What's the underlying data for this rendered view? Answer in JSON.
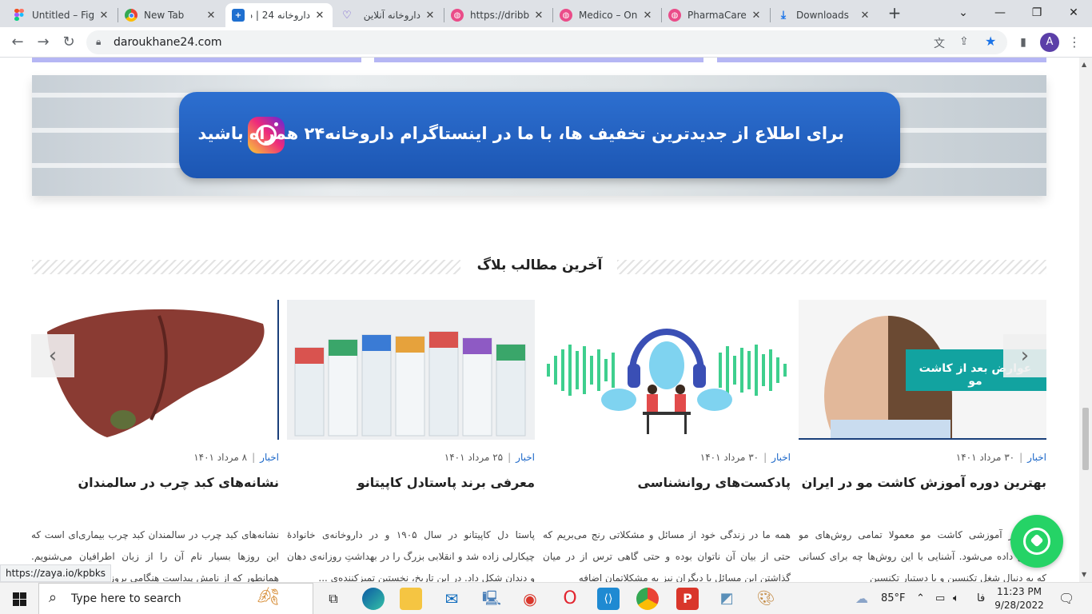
{
  "browser": {
    "tabs": [
      {
        "title": "Untitled – Fig",
        "icon": "figma-icon"
      },
      {
        "title": "New Tab",
        "icon": "chrome-icon"
      },
      {
        "title": "داروخانه 24 | د",
        "icon": "pharmacy-plus-icon",
        "active": true
      },
      {
        "title": "داروخانه آنلاین",
        "icon": "heart-pulse-icon"
      },
      {
        "title": "https://dribbb",
        "icon": "dribbble-icon"
      },
      {
        "title": "Medico – Onl",
        "icon": "dribbble-icon"
      },
      {
        "title": "PharmaCare -",
        "icon": "dribbble-icon"
      },
      {
        "title": "Downloads",
        "icon": "download-icon"
      }
    ],
    "url": "daroukhane24.com",
    "profile_initial": "A"
  },
  "banner": {
    "text": "برای اطلاع از جدیدترین تخفیف ها، با ما در اینستاگرام داروخانه۲۴ همراه باشید"
  },
  "blog": {
    "section_title": "آخرین مطالب بلاگ",
    "posts": [
      {
        "category": "اخبار",
        "date": "۳۰ مرداد ۱۴۰۱",
        "title": "بهترین دوره آموزش کاشت مو در ایران",
        "image_caption": "عوارض بعد از کاشت مو",
        "excerpt": "های برتر آموزشی کاشت مو معمولا تمامی روش‌های مو آموزش داده می‌شود. آشنایی با این روش‌ها چه برای کسانی که به دنبال شغل تکنسین و یا دستیار تکنسین"
      },
      {
        "category": "اخبار",
        "date": "۳۰ مرداد ۱۴۰۱",
        "title": "پادکست‌های روانشناسی",
        "excerpt": "همه ما در زندگی خود از مسائل و مشکلاتی رنج می‌بریم که حتی از بیان آن ناتوان بوده و حتی گاهی ترس از در میان گذاشتن این مسائل با دیگران نیز به مشکلاتمان اضافه"
      },
      {
        "category": "اخبار",
        "date": "۲۵ مرداد ۱۴۰۱",
        "title": "معرفی برند پاستادل کاپیتانو",
        "excerpt": "پاستا دل کاپیتانو در سال ۱۹۰۵ و در داروخانه‌ی خانوادهٔ چیکارلی زاده شد و انقلابی بزرگ را در بهداشتِ روزانه‌ی دهان و دندان شکل داد. در این تاریخ، نخستین تمیزکننده‌ی ..."
      },
      {
        "category": "اخبار",
        "date": "۸ مرداد ۱۴۰۱",
        "title": "نشانه‌های کبد چرب در سالمندان",
        "excerpt": "نشانه‌های کبد چرب در سالمندان کبد چرب بیماری‌ای است که این روزها بسیار نام آن را از زبان اطرافیان می‌شنویم. همانطور که از نامش پیداست هنگامی بروز"
      }
    ]
  },
  "status_link": "https://zaya.io/kpbks",
  "taskbar": {
    "search_placeholder": "Type here to search",
    "weather": "85°F",
    "lang": "فا",
    "time": "11:23 PM",
    "date": "9/28/2022"
  }
}
